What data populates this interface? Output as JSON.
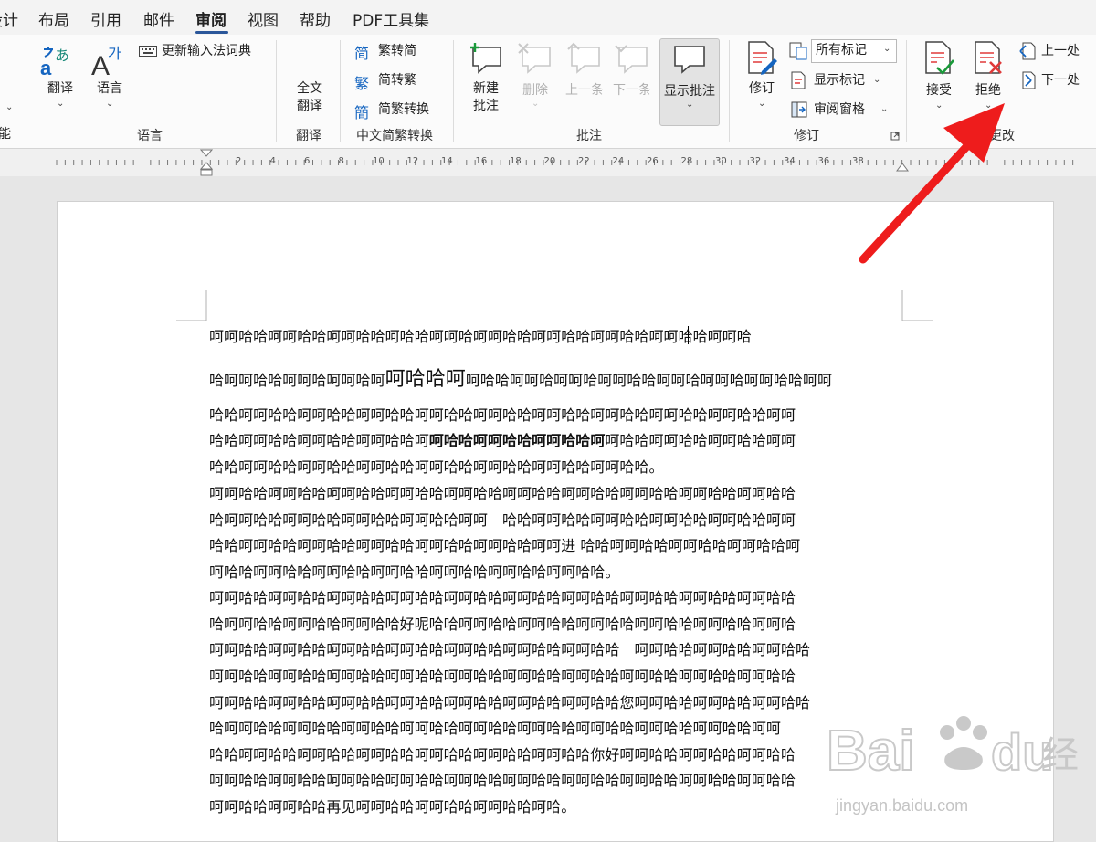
{
  "tabs": [
    "设计",
    "布局",
    "引用",
    "邮件",
    "审阅",
    "视图",
    "帮助",
    "PDF工具集"
  ],
  "active_tab": "审阅",
  "ribbon": {
    "left_edge_label": "能",
    "translate_label": "翻译",
    "language_label": "语言",
    "update_ime_label": "更新输入法词典",
    "full_translate_line1": "全文",
    "full_translate_line2": "翻译",
    "trad_to_simp_label": "繁转简",
    "simp_to_trad_label": "简转繁",
    "simp_trad_convert_label": "简繁转换",
    "new_comment_line1": "新建",
    "new_comment_line2": "批注",
    "delete_label": "删除",
    "prev_label": "上一条",
    "next_label": "下一条",
    "show_comments_label": "显示批注",
    "track_changes_label": "修订",
    "markup_dropdown_value": "所有标记",
    "show_markup_label": "显示标记",
    "review_pane_label": "审阅窗格",
    "accept_label": "接受",
    "reject_label": "拒绝",
    "prev_change_label": "上一处",
    "next_change_label": "下一处",
    "groups": {
      "language": "语言",
      "translate": "翻译",
      "chinese_convert": "中文简繁转换",
      "comments": "批注",
      "tracking": "修订",
      "changes": "更改"
    }
  },
  "ruler_numbers": [
    "2",
    "4",
    "6",
    "8",
    "10",
    "12",
    "14",
    "16",
    "18",
    "20",
    "22",
    "24",
    "26",
    "28",
    "30",
    "32",
    "34",
    "36",
    "38"
  ],
  "document": {
    "line1": "呵呵哈哈呵呵哈哈呵呵哈哈呵哈哈呵呵哈呵呵哈哈呵呵哈哈呵呵哈哈呵呵哈哈呵呵哈",
    "line2_a": "哈呵呵哈哈呵呵哈呵呵哈呵",
    "line2_big": "呵哈哈呵",
    "line2_b": "呵哈哈呵呵哈呵呵哈呵呵哈哈呵呵哈呵呵哈呵呵哈哈呵呵",
    "line3": "哈哈呵呵哈哈呵呵哈哈呵呵哈哈呵呵哈哈呵呵哈哈呵呵哈哈呵呵哈哈呵呵哈哈呵呵哈哈呵呵",
    "line4_a": "哈哈呵呵哈哈呵呵哈哈呵呵哈哈呵",
    "line4_bold": "呵哈哈呵呵哈哈呵呵哈哈呵",
    "line4_b": "呵哈哈呵呵哈哈呵呵哈哈呵呵",
    "line5": "哈哈呵呵哈哈呵呵哈哈呵呵哈哈呵呵哈哈呵呵哈哈呵呵哈哈呵呵哈哈。",
    "line6": "呵呵哈哈呵呵哈哈呵呵哈哈呵呵哈哈呵呵哈哈呵呵哈哈呵呵哈哈呵呵哈哈呵呵哈哈呵呵哈哈",
    "line7": "哈呵呵哈哈呵呵哈哈呵呵哈哈呵呵哈哈呵呵　哈哈呵呵哈哈呵呵哈哈呵呵哈哈呵呵哈哈呵呵",
    "line8": "哈哈呵呵哈哈呵呵哈哈呵呵哈哈呵呵哈哈呵呵哈哈呵呵进 哈哈呵呵哈哈呵呵哈哈呵呵哈哈呵",
    "line9": "呵哈哈呵呵哈哈呵呵哈哈呵呵哈哈呵呵哈哈呵呵哈哈呵呵哈哈。",
    "line10": "呵呵哈哈呵呵哈哈呵呵哈哈呵呵哈哈呵呵哈哈呵呵哈哈呵呵哈哈呵呵哈哈呵呵哈哈呵呵哈哈",
    "line11": "哈呵呵哈哈呵呵哈哈呵呵哈哈好呢哈哈呵呵哈哈呵呵哈哈呵呵哈哈呵呵哈哈呵呵哈哈呵呵哈",
    "line12": "呵呵哈哈呵呵哈哈呵呵哈哈呵呵哈哈呵呵哈哈呵呵哈哈呵呵哈哈　呵呵哈哈呵呵哈哈呵呵哈哈",
    "line13": "呵呵哈哈呵呵哈哈呵呵哈哈呵呵哈哈呵呵哈哈呵呵哈哈呵呵哈哈呵呵哈哈呵呵哈哈呵呵哈哈",
    "line14": "呵呵哈哈呵呵哈哈呵呵哈哈呵呵哈哈呵呵哈哈呵呵哈哈呵呵哈哈您呵呵哈哈呵呵哈哈呵呵哈哈",
    "line15": "哈呵呵哈哈呵呵哈哈呵呵哈哈呵呵哈哈呵呵哈哈呵呵哈哈呵呵哈哈呵呵哈哈呵呵哈哈呵呵",
    "line16": "哈哈呵呵哈哈呵呵哈哈呵呵哈哈呵呵哈哈呵呵哈哈呵呵哈哈你好呵呵哈哈呵呵哈哈呵呵哈哈",
    "line17": "呵呵哈哈呵呵哈哈呵呵哈哈呵呵哈哈呵呵哈哈呵呵哈哈呵呵哈哈呵呵哈哈呵呵哈哈呵呵哈哈",
    "line18": "呵呵哈哈呵呵哈哈再见呵呵哈哈呵呵哈哈呵呵哈哈呵哈。"
  },
  "watermark_text": "jingyan.baidu.com",
  "colors": {
    "accent": "#2b579a",
    "arrow": "#ee1c1c",
    "icon_red": "#e03a3a",
    "icon_teal": "#1a8a7a",
    "icon_blue": "#1565c0"
  }
}
